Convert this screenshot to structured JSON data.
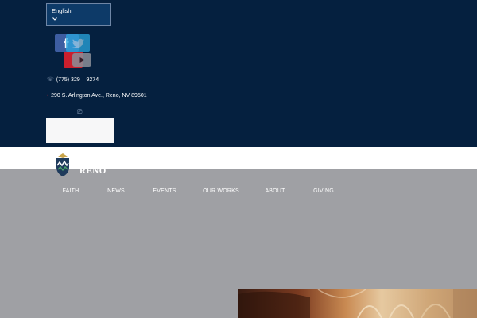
{
  "language": {
    "selected": "English"
  },
  "social": {
    "icons": [
      "facebook-icon",
      "twitter-icon",
      "youtube-icon"
    ]
  },
  "contact": {
    "phone": "(775) 329 – 9274",
    "address": "290 S. Arlington Ave., Reno, NV 89501"
  },
  "brand": {
    "name": "RENO"
  },
  "nav": {
    "items": [
      {
        "label": "FAITH"
      },
      {
        "label": "NEWS"
      },
      {
        "label": "EVENTS"
      },
      {
        "label": "OUR WORKS"
      },
      {
        "label": "ABOUT"
      },
      {
        "label": "GIVING"
      }
    ]
  },
  "colors": {
    "topbar_bg": "#05203f",
    "main_bg": "#9fa0a4",
    "accent_red": "#c22a36",
    "facebook": "#3d5da1",
    "twitter": "#2aa7e0",
    "youtube": "#cc1f2d"
  }
}
